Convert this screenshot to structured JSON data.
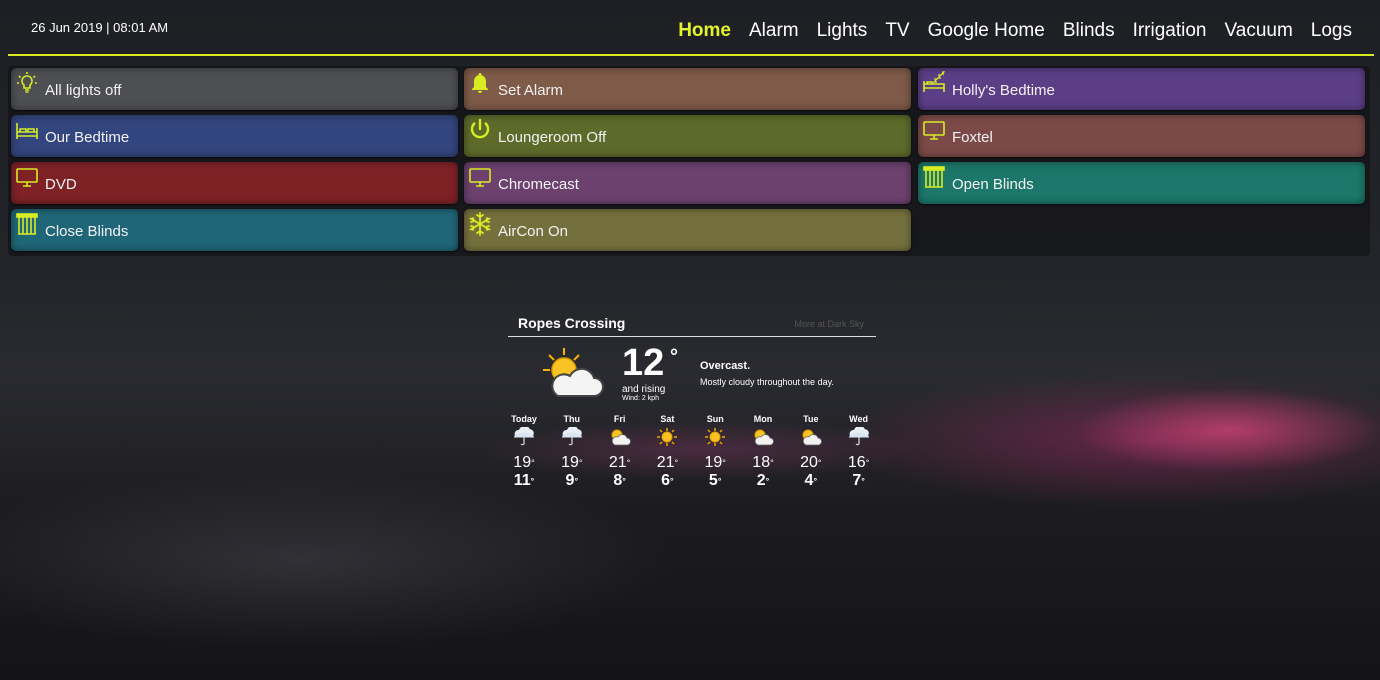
{
  "header": {
    "datetime": "26 Jun 2019 | 08:01 AM",
    "nav": [
      "Home",
      "Alarm",
      "Lights",
      "TV",
      "Google Home",
      "Blinds",
      "Irrigation",
      "Vacuum",
      "Logs"
    ],
    "active_nav": "Home"
  },
  "colors": {
    "accent": "#e2f52a"
  },
  "tiles": [
    {
      "label": "All lights off",
      "icon": "lightbulb-icon",
      "color": "#4e4f52"
    },
    {
      "label": "Set Alarm",
      "icon": "bell-icon",
      "color": "#7e5a48"
    },
    {
      "label": "Holly's Bedtime",
      "icon": "sleep-bed-icon",
      "color": "#5b3e86"
    },
    {
      "label": "Our Bedtime",
      "icon": "bed-icon",
      "color": "#33457e"
    },
    {
      "label": "Loungeroom Off",
      "icon": "power-icon",
      "color": "#5d6a2a"
    },
    {
      "label": "Foxtel",
      "icon": "tv-icon",
      "color": "#7b4a48"
    },
    {
      "label": "DVD",
      "icon": "tv-icon",
      "color": "#7e2226"
    },
    {
      "label": "Chromecast",
      "icon": "tv-icon",
      "color": "#6c416e"
    },
    {
      "label": "Open Blinds",
      "icon": "blinds-icon",
      "color": "#1c7669"
    },
    {
      "label": "Close Blinds",
      "icon": "blinds-icon",
      "color": "#1f6678"
    },
    {
      "label": "AirCon On",
      "icon": "snowflake-icon",
      "color": "#74703e"
    }
  ],
  "weather": {
    "location": "Ropes Crossing",
    "more_link": "More at Dark Sky",
    "current": {
      "temp": "12",
      "degree": "°",
      "trend": "and rising",
      "wind": "Wind: 2 kph",
      "condition": "Overcast.",
      "summary": "Mostly cloudy throughout the day.",
      "icon": "partly-cloudy-icon"
    },
    "forecast": [
      {
        "day": "Today",
        "icon": "rain-icon",
        "high": "19",
        "low": "11"
      },
      {
        "day": "Thu",
        "icon": "rain-icon",
        "high": "19",
        "low": "9"
      },
      {
        "day": "Fri",
        "icon": "partly-cloudy-icon",
        "high": "21",
        "low": "8"
      },
      {
        "day": "Sat",
        "icon": "sun-icon",
        "high": "21",
        "low": "6"
      },
      {
        "day": "Sun",
        "icon": "sun-icon",
        "high": "19",
        "low": "5"
      },
      {
        "day": "Mon",
        "icon": "partly-cloudy-icon",
        "high": "18",
        "low": "2"
      },
      {
        "day": "Tue",
        "icon": "partly-cloudy-icon",
        "high": "20",
        "low": "4"
      },
      {
        "day": "Wed",
        "icon": "rain-icon",
        "high": "16",
        "low": "7"
      }
    ]
  }
}
